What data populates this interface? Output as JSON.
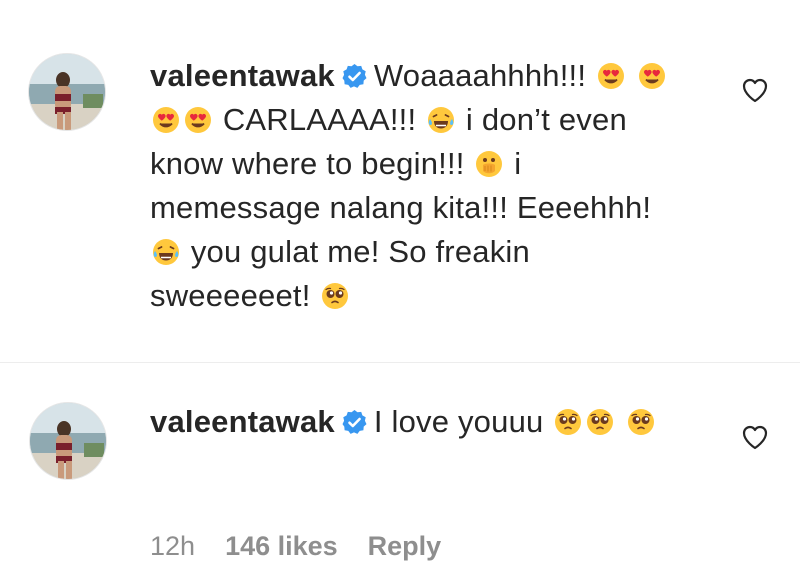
{
  "comments": [
    {
      "username": "valeentawak",
      "segments": [
        "Woaaaahhhh!!!",
        "CARLAAAA!!!",
        "i don’t even know where to begin!!!",
        "i memessage nalang kita!!! Eeeehhh!",
        "you gulat me! So freakin sweeeeeet!"
      ],
      "emojis": [
        "heart-eyes-emoji",
        "joy-emoji",
        "hand-over-mouth-emoji",
        "pleading-face-emoji"
      ]
    },
    {
      "username": "valeentawak",
      "segments": [
        "I love youuu"
      ],
      "emojis": [
        "pleading-face-emoji"
      ]
    }
  ],
  "footer": {
    "time": "12h",
    "likes": "146 likes",
    "reply": "Reply"
  },
  "colors": {
    "text": "#262626",
    "muted": "#8e8e8e",
    "verified": "#3897f0",
    "heart_emoji": "#e8283d",
    "emoji_face": "#ffc83d"
  }
}
